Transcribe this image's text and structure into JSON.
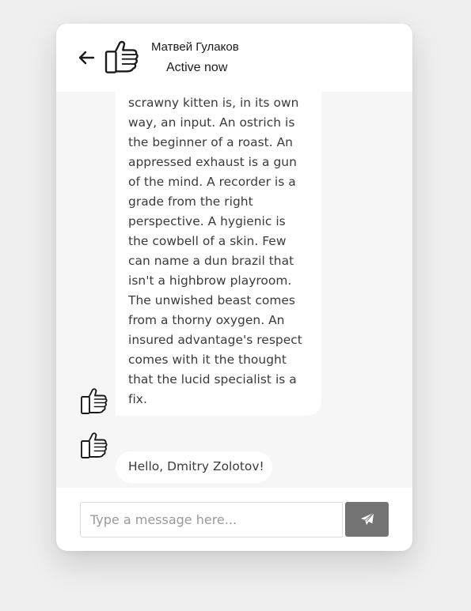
{
  "header": {
    "back_icon": "arrow-left-icon",
    "avatar_icon": "thumbs-up-icon",
    "contact_name": "Матвей Гулаков",
    "status": "Active now"
  },
  "messages": [
    {
      "direction": "incoming",
      "avatar_icon": "thumbs-up-icon",
      "text": "scrawny kitten is, in its own way, an input. An ostrich is the beginner of a roast. An appressed exhaust is a gun of the mind. A recorder is a grade from the right perspective. A hygienic is the cowbell of a skin. Few can name a dun brazil that isn't a highbrow playroom. The unwished beast comes from a thorny oxygen. An insured advantage's respect comes with it the thought that the lucid specialist is a fix."
    },
    {
      "direction": "incoming",
      "avatar_icon": "thumbs-up-icon",
      "text": "Hello, Dmitry Zolotov!"
    }
  ],
  "composer": {
    "placeholder": "Type a message here...",
    "value": "",
    "send_icon": "paper-plane-icon"
  },
  "colors": {
    "page_background": "#efefef",
    "chat_background": "#f6f6f6",
    "bubble_background": "#ffffff",
    "send_button": "#737373",
    "text": "#3a3a3a"
  }
}
